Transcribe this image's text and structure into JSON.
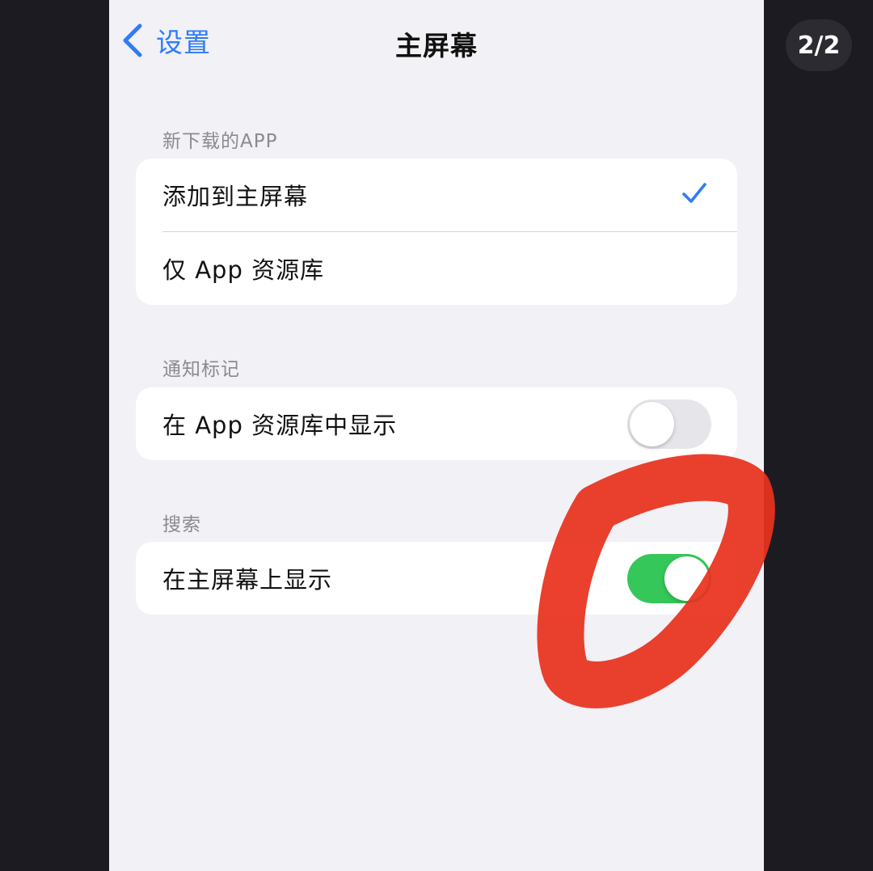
{
  "nav": {
    "back_label": "设置",
    "title": "主屏幕"
  },
  "sections": [
    {
      "label": "新下载的APP",
      "rows": [
        {
          "label": "添加到主屏幕",
          "selected": true
        },
        {
          "label": "仅 App 资源库",
          "selected": false
        }
      ]
    },
    {
      "label": "通知标记",
      "rows": [
        {
          "label": "在 App 资源库中显示",
          "toggle": "off"
        }
      ]
    },
    {
      "label": "搜索",
      "rows": [
        {
          "label": "在主屏幕上显示",
          "toggle": "on"
        }
      ]
    }
  ],
  "page_indicator": "2/2",
  "colors": {
    "accent": "#2f7cf6",
    "toggle_on": "#35c759",
    "toggle_off": "#e6e6ea",
    "annotation": "#e8321d",
    "background": "#f1f1f6"
  }
}
